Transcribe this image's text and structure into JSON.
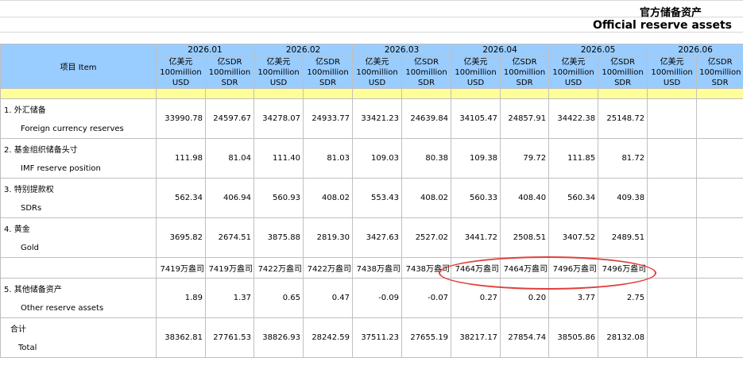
{
  "title": {
    "cn": "官方储备资产",
    "en": "Official reserve assets"
  },
  "header": {
    "item_label": "项目 Item",
    "months": [
      "2026.01",
      "2026.02",
      "2026.03",
      "2026.04",
      "2026.05",
      "2026.06"
    ],
    "unit_usd": "亿美元 100million USD",
    "unit_sdr": "亿SDR 100million SDR"
  },
  "rows": [
    {
      "cn": "1. 外汇储备",
      "en": "Foreign currency reserves",
      "values": [
        "33990.78",
        "24597.67",
        "34278.07",
        "24933.77",
        "33421.23",
        "24639.84",
        "34105.47",
        "24857.91",
        "34422.38",
        "25148.72",
        "",
        ""
      ]
    },
    {
      "cn": "2. 基金组织储备头寸",
      "en": "IMF reserve position",
      "values": [
        "111.98",
        "81.04",
        "111.40",
        "81.03",
        "109.03",
        "80.38",
        "109.38",
        "79.72",
        "111.85",
        "81.72",
        "",
        ""
      ]
    },
    {
      "cn": "3. 特别提款权",
      "en": "SDRs",
      "values": [
        "562.34",
        "406.94",
        "560.93",
        "408.02",
        "553.43",
        "408.02",
        "560.33",
        "408.40",
        "560.34",
        "409.38",
        "",
        ""
      ]
    },
    {
      "cn": "4. 黄金",
      "en": "Gold",
      "values": [
        "3695.82",
        "2674.51",
        "3875.88",
        "2819.30",
        "3427.63",
        "2527.02",
        "3441.72",
        "2508.51",
        "3407.52",
        "2489.51",
        "",
        ""
      ]
    }
  ],
  "gold_oz": [
    "7419万盎司",
    "7419万盎司",
    "7422万盎司",
    "7422万盎司",
    "7438万盎司",
    "7438万盎司",
    "7464万盎司",
    "7464万盎司",
    "7496万盎司",
    "7496万盎司",
    "",
    ""
  ],
  "rows2": [
    {
      "cn": "5. 其他储备资产",
      "en": "Other reserve assets",
      "values": [
        "1.89",
        "1.37",
        "0.65",
        "0.47",
        "-0.09",
        "-0.07",
        "0.27",
        "0.20",
        "3.77",
        "2.75",
        "",
        ""
      ]
    },
    {
      "cn": "合计",
      "en": "Total",
      "values": [
        "38362.81",
        "27761.53",
        "38826.93",
        "28242.59",
        "37511.23",
        "27655.19",
        "38217.17",
        "27854.74",
        "38505.86",
        "28132.08",
        "",
        ""
      ]
    }
  ]
}
